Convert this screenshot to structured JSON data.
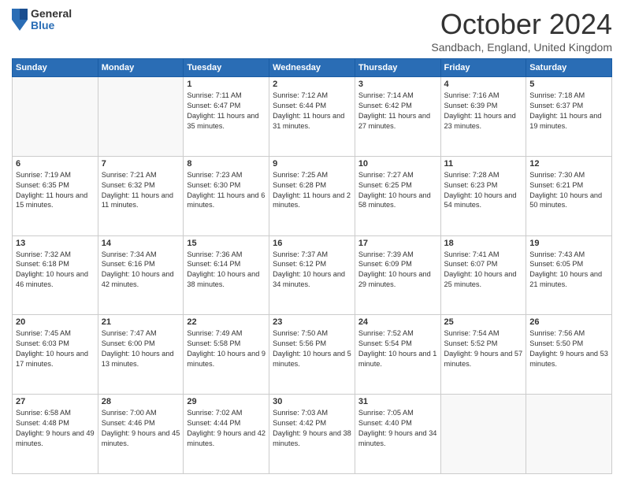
{
  "header": {
    "logo_general": "General",
    "logo_blue": "Blue",
    "month_title": "October 2024",
    "location": "Sandbach, England, United Kingdom"
  },
  "days_of_week": [
    "Sunday",
    "Monday",
    "Tuesday",
    "Wednesday",
    "Thursday",
    "Friday",
    "Saturday"
  ],
  "weeks": [
    [
      {
        "day": "",
        "info": ""
      },
      {
        "day": "",
        "info": ""
      },
      {
        "day": "1",
        "info": "Sunrise: 7:11 AM\nSunset: 6:47 PM\nDaylight: 11 hours and 35 minutes."
      },
      {
        "day": "2",
        "info": "Sunrise: 7:12 AM\nSunset: 6:44 PM\nDaylight: 11 hours and 31 minutes."
      },
      {
        "day": "3",
        "info": "Sunrise: 7:14 AM\nSunset: 6:42 PM\nDaylight: 11 hours and 27 minutes."
      },
      {
        "day": "4",
        "info": "Sunrise: 7:16 AM\nSunset: 6:39 PM\nDaylight: 11 hours and 23 minutes."
      },
      {
        "day": "5",
        "info": "Sunrise: 7:18 AM\nSunset: 6:37 PM\nDaylight: 11 hours and 19 minutes."
      }
    ],
    [
      {
        "day": "6",
        "info": "Sunrise: 7:19 AM\nSunset: 6:35 PM\nDaylight: 11 hours and 15 minutes."
      },
      {
        "day": "7",
        "info": "Sunrise: 7:21 AM\nSunset: 6:32 PM\nDaylight: 11 hours and 11 minutes."
      },
      {
        "day": "8",
        "info": "Sunrise: 7:23 AM\nSunset: 6:30 PM\nDaylight: 11 hours and 6 minutes."
      },
      {
        "day": "9",
        "info": "Sunrise: 7:25 AM\nSunset: 6:28 PM\nDaylight: 11 hours and 2 minutes."
      },
      {
        "day": "10",
        "info": "Sunrise: 7:27 AM\nSunset: 6:25 PM\nDaylight: 10 hours and 58 minutes."
      },
      {
        "day": "11",
        "info": "Sunrise: 7:28 AM\nSunset: 6:23 PM\nDaylight: 10 hours and 54 minutes."
      },
      {
        "day": "12",
        "info": "Sunrise: 7:30 AM\nSunset: 6:21 PM\nDaylight: 10 hours and 50 minutes."
      }
    ],
    [
      {
        "day": "13",
        "info": "Sunrise: 7:32 AM\nSunset: 6:18 PM\nDaylight: 10 hours and 46 minutes."
      },
      {
        "day": "14",
        "info": "Sunrise: 7:34 AM\nSunset: 6:16 PM\nDaylight: 10 hours and 42 minutes."
      },
      {
        "day": "15",
        "info": "Sunrise: 7:36 AM\nSunset: 6:14 PM\nDaylight: 10 hours and 38 minutes."
      },
      {
        "day": "16",
        "info": "Sunrise: 7:37 AM\nSunset: 6:12 PM\nDaylight: 10 hours and 34 minutes."
      },
      {
        "day": "17",
        "info": "Sunrise: 7:39 AM\nSunset: 6:09 PM\nDaylight: 10 hours and 29 minutes."
      },
      {
        "day": "18",
        "info": "Sunrise: 7:41 AM\nSunset: 6:07 PM\nDaylight: 10 hours and 25 minutes."
      },
      {
        "day": "19",
        "info": "Sunrise: 7:43 AM\nSunset: 6:05 PM\nDaylight: 10 hours and 21 minutes."
      }
    ],
    [
      {
        "day": "20",
        "info": "Sunrise: 7:45 AM\nSunset: 6:03 PM\nDaylight: 10 hours and 17 minutes."
      },
      {
        "day": "21",
        "info": "Sunrise: 7:47 AM\nSunset: 6:00 PM\nDaylight: 10 hours and 13 minutes."
      },
      {
        "day": "22",
        "info": "Sunrise: 7:49 AM\nSunset: 5:58 PM\nDaylight: 10 hours and 9 minutes."
      },
      {
        "day": "23",
        "info": "Sunrise: 7:50 AM\nSunset: 5:56 PM\nDaylight: 10 hours and 5 minutes."
      },
      {
        "day": "24",
        "info": "Sunrise: 7:52 AM\nSunset: 5:54 PM\nDaylight: 10 hours and 1 minute."
      },
      {
        "day": "25",
        "info": "Sunrise: 7:54 AM\nSunset: 5:52 PM\nDaylight: 9 hours and 57 minutes."
      },
      {
        "day": "26",
        "info": "Sunrise: 7:56 AM\nSunset: 5:50 PM\nDaylight: 9 hours and 53 minutes."
      }
    ],
    [
      {
        "day": "27",
        "info": "Sunrise: 6:58 AM\nSunset: 4:48 PM\nDaylight: 9 hours and 49 minutes."
      },
      {
        "day": "28",
        "info": "Sunrise: 7:00 AM\nSunset: 4:46 PM\nDaylight: 9 hours and 45 minutes."
      },
      {
        "day": "29",
        "info": "Sunrise: 7:02 AM\nSunset: 4:44 PM\nDaylight: 9 hours and 42 minutes."
      },
      {
        "day": "30",
        "info": "Sunrise: 7:03 AM\nSunset: 4:42 PM\nDaylight: 9 hours and 38 minutes."
      },
      {
        "day": "31",
        "info": "Sunrise: 7:05 AM\nSunset: 4:40 PM\nDaylight: 9 hours and 34 minutes."
      },
      {
        "day": "",
        "info": ""
      },
      {
        "day": "",
        "info": ""
      }
    ]
  ]
}
